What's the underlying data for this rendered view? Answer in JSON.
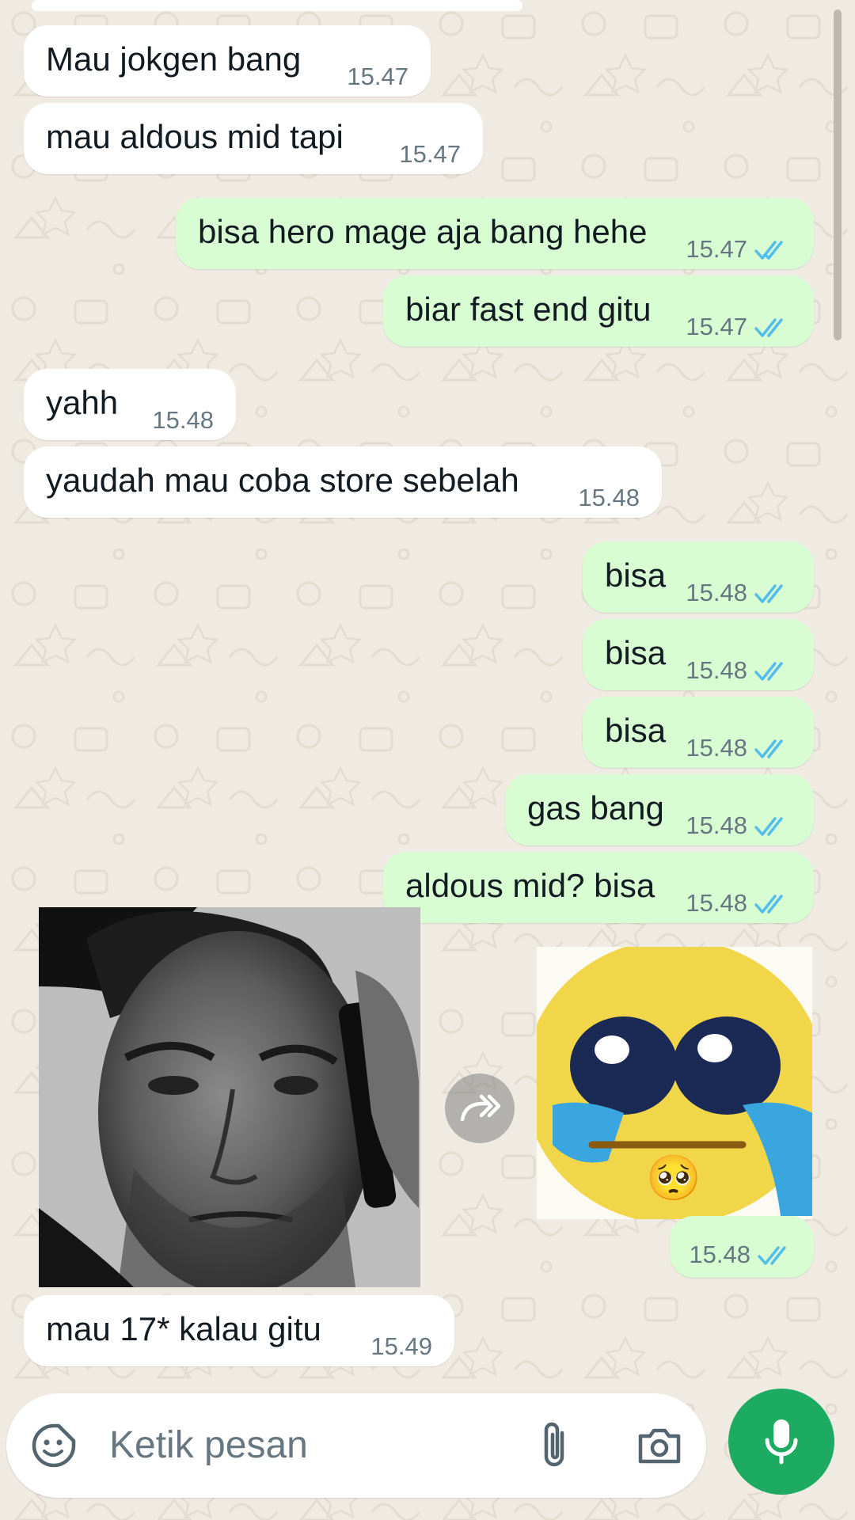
{
  "colors": {
    "wallpaper": "#efeae2",
    "incoming_bubble": "#ffffff",
    "outgoing_bubble": "#d9fdd3",
    "read_ticks": "#53bdeb",
    "mic_button": "#1daa61",
    "timestamp": "#667781"
  },
  "messages": [
    {
      "text": "Mau jokgen bang",
      "time": "15.47",
      "dir": "in"
    },
    {
      "text": "mau aldous mid tapi",
      "time": "15.47",
      "dir": "in"
    },
    {
      "text": "bisa hero mage aja bang hehe",
      "time": "15.47",
      "dir": "out",
      "status": "read"
    },
    {
      "text": "biar fast end gitu",
      "time": "15.47",
      "dir": "out",
      "status": "read"
    },
    {
      "text": "yahh",
      "time": "15.48",
      "dir": "in"
    },
    {
      "text": "yaudah mau coba store sebelah",
      "time": "15.48",
      "dir": "in"
    },
    {
      "text": "bisa",
      "time": "15.48",
      "dir": "out",
      "status": "read"
    },
    {
      "text": "bisa",
      "time": "15.48",
      "dir": "out",
      "status": "read"
    },
    {
      "text": "bisa",
      "time": "15.48",
      "dir": "out",
      "status": "read"
    },
    {
      "text": "gas bang",
      "time": "15.48",
      "dir": "out",
      "status": "read"
    },
    {
      "text": "aldous mid? bisa",
      "time": "15.48",
      "dir": "out",
      "status": "read"
    },
    {
      "media": "crying-man-on-phone-photo",
      "dir": "in"
    },
    {
      "media": "crying-emoji-sticker",
      "sticker_emoji": "🥺",
      "time": "15.48",
      "dir": "out",
      "status": "read"
    },
    {
      "text": "mau 17* kalau gitu",
      "time": "15.49",
      "dir": "in"
    }
  ],
  "composer": {
    "placeholder": "Ketik pesan",
    "icons": [
      "sticker-icon",
      "attach-icon",
      "camera-icon",
      "mic-icon"
    ]
  }
}
